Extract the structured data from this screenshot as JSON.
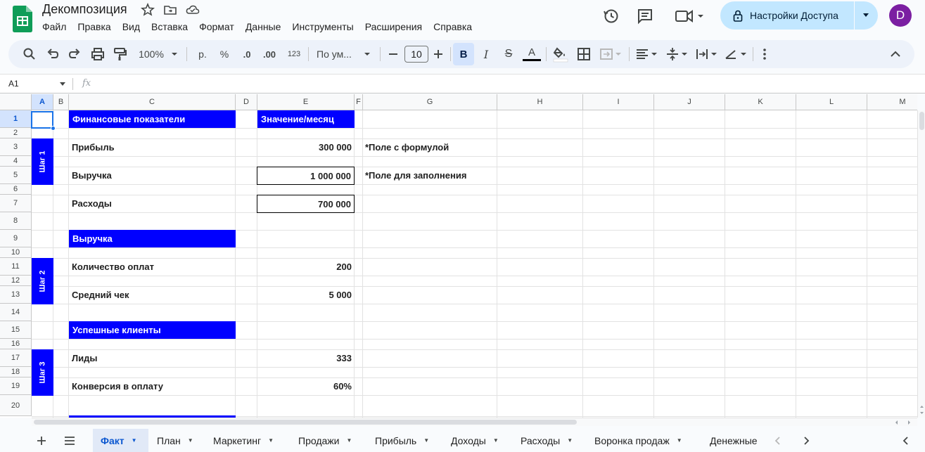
{
  "title_bar": {
    "doc_title": "Декомпозиция",
    "share_label": "Настройки Доступа",
    "avatar_letter": "D"
  },
  "menu": [
    "Файл",
    "Правка",
    "Вид",
    "Вставка",
    "Формат",
    "Данные",
    "Инструменты",
    "Расширения",
    "Справка"
  ],
  "toolbar": {
    "zoom": "100%",
    "currency": "р.",
    "percent": "%",
    "dec_less": ".0",
    "dec_more": ".00",
    "number_format": "123",
    "font": "По ум...",
    "font_size": "10",
    "bold": "B",
    "italic": "I",
    "strike": "S",
    "text_color": "A"
  },
  "formula_bar": {
    "name_box": "A1",
    "fx": "fx"
  },
  "columns": [
    "A",
    "B",
    "C",
    "D",
    "E",
    "F",
    "G",
    "H",
    "I",
    "J",
    "K",
    "L",
    "M"
  ],
  "rows": [
    "1",
    "2",
    "3",
    "4",
    "5",
    "6",
    "7",
    "8",
    "9",
    "10",
    "11",
    "12",
    "13",
    "14",
    "15",
    "16",
    "17",
    "18",
    "19",
    "20"
  ],
  "cells": {
    "c1": "Финансовые показатели",
    "e1": "Значение/месяц",
    "c3": "Прибыль",
    "e3": "300 000",
    "g3": "*Поле с формулой",
    "c5": "Выручка",
    "e5": "1 000 000",
    "g5": "*Поле для заполнения",
    "c7": "Расходы",
    "e7": "700 000",
    "c9": "Выручка",
    "c11": "Количество оплат",
    "e11": "200",
    "c13": "Средний чек",
    "e13": "5 000",
    "c15": "Успешные клиенты",
    "c17": "Лиды",
    "e17": "333",
    "c19": "Конверсия в оплату",
    "e19": "60%"
  },
  "steps": [
    "Шаг 1",
    "Шаг 2",
    "Шаг 3"
  ],
  "sheet_tabs": [
    "Факт",
    "План",
    "Маркетинг",
    "Продажи",
    "Прибыль",
    "Доходы",
    "Расходы",
    "Воронка продаж",
    "Денежные"
  ],
  "active_tab": "Факт",
  "colors": {
    "accent_blue": "#0000ff",
    "selection": "#1a73e8",
    "share_bg": "#c2e7ff",
    "avatar": "#7b1fa2"
  }
}
